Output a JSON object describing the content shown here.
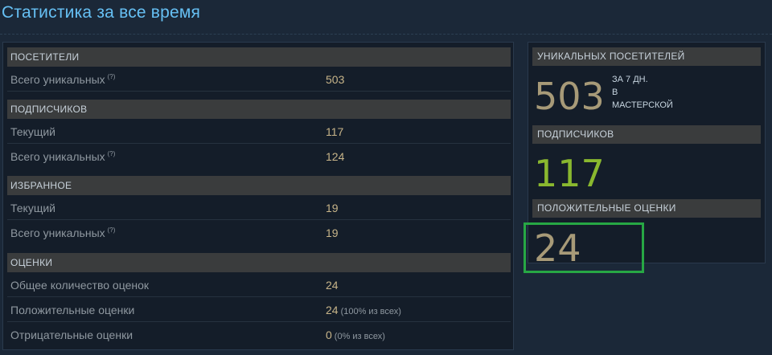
{
  "page": {
    "title": "Статистика за все время"
  },
  "stats": {
    "visitors": {
      "header": "ПОСЕТИТЕЛИ",
      "rows": [
        {
          "label": "Всего уникальных",
          "help": "(?)",
          "value": "503"
        }
      ]
    },
    "subscribers": {
      "header": "ПОДПИСЧИКОВ",
      "rows": [
        {
          "label": "Текущий",
          "value": "117"
        },
        {
          "label": "Всего уникальных",
          "help": "(?)",
          "value": "124"
        }
      ]
    },
    "favorites": {
      "header": "ИЗБРАННОЕ",
      "rows": [
        {
          "label": "Текущий",
          "value": "19"
        },
        {
          "label": "Всего уникальных",
          "help": "(?)",
          "value": "19"
        }
      ]
    },
    "ratings": {
      "header": "ОЦЕНКИ",
      "rows": [
        {
          "label": "Общее количество оценок",
          "value": "24"
        },
        {
          "label": "Положительные оценки",
          "value": "24",
          "note": "(100% из всех)"
        },
        {
          "label": "Отрицательные оценки",
          "value": "0",
          "note": "(0% из всех)"
        }
      ]
    }
  },
  "summary": {
    "unique_visitors": {
      "header": "УНИКАЛЬНЫХ ПОСЕТИТЕЛЕЙ",
      "value": "503",
      "note_line1": "ЗА 7 ДН.",
      "note_line2": "В",
      "note_line3": "МАСТЕРСКОЙ"
    },
    "subscribers": {
      "header": "ПОДПИСЧИКОВ",
      "value": "117"
    },
    "positive_ratings": {
      "header": "ПОЛОЖИТЕЛЬНЫЕ ОЦЕНКИ",
      "value": "24"
    }
  },
  "colors": {
    "background": "#1b2838",
    "title": "#66c0f4",
    "value_tan": "#c7b489",
    "big_green": "#8ab82f",
    "highlight": "#27a744"
  }
}
